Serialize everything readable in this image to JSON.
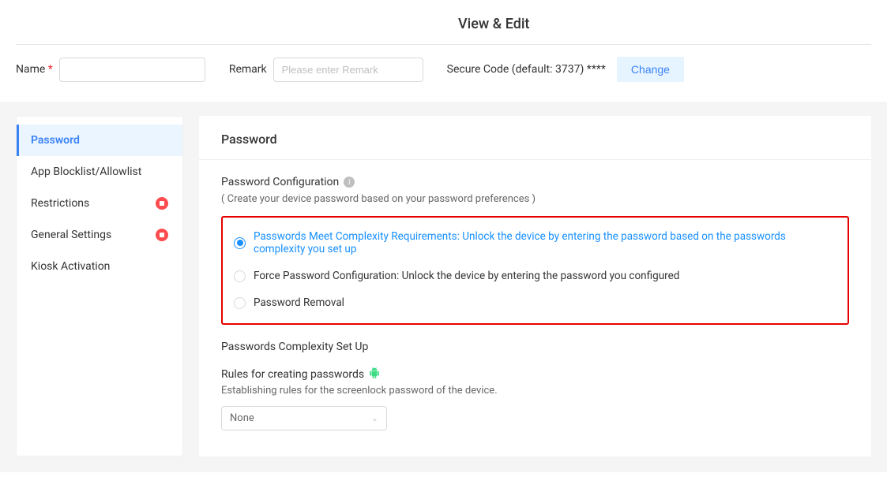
{
  "header": {
    "title": "View & Edit"
  },
  "form": {
    "name_label": "Name",
    "name_value": "",
    "remark_label": "Remark",
    "remark_placeholder": "Please enter Remark",
    "secure_code_label": "Secure Code (default: 3737)",
    "secure_code_masked": "****",
    "change_button": "Change"
  },
  "sidebar": {
    "items": [
      {
        "label": "Password",
        "active": true
      },
      {
        "label": "App Blocklist/Allowlist",
        "active": false
      },
      {
        "label": "Restrictions",
        "active": false,
        "badge": true
      },
      {
        "label": "General Settings",
        "active": false,
        "badge": true
      },
      {
        "label": "Kiosk Activation",
        "active": false
      }
    ]
  },
  "content": {
    "heading": "Password",
    "config_title": "Password Configuration",
    "config_desc": "( Create your device password based on your password preferences )",
    "options": [
      {
        "label": "Passwords Meet Complexity Requirements: Unlock the device by entering the password based on the passwords complexity you set up",
        "checked": true
      },
      {
        "label": "Force Password Configuration: Unlock the device by entering the password you configured",
        "checked": false
      },
      {
        "label": "Password Removal",
        "checked": false
      }
    ],
    "complexity_title": "Passwords Complexity Set Up",
    "rules_title": "Rules for creating passwords",
    "rules_desc": "Establishing rules for the screenlock password of the device.",
    "select_value": "None"
  }
}
